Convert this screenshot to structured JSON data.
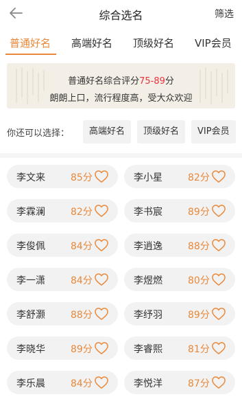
{
  "header": {
    "title": "综合选名",
    "filter_label": "筛选",
    "back_icon": "back-arrow-icon"
  },
  "tabs": [
    {
      "label": "普通好名",
      "active": true
    },
    {
      "label": "高端好名",
      "active": false
    },
    {
      "label": "顶级好名",
      "active": false
    },
    {
      "label": "VIP会员",
      "active": false
    }
  ],
  "banner": {
    "line1_prefix": "普通好名综合评分",
    "score_range": "75-89",
    "line1_suffix": "分",
    "line2": "朗朗上口，流行程度高，受大众欢迎"
  },
  "choose": {
    "label": "你还可以选择：",
    "options": [
      "高端好名",
      "顶级好名",
      "VIP会员"
    ]
  },
  "names": [
    {
      "name": "李文来",
      "score": "85分"
    },
    {
      "name": "李小星",
      "score": "82分"
    },
    {
      "name": "李霖澜",
      "score": "82分"
    },
    {
      "name": "李书宸",
      "score": "89分"
    },
    {
      "name": "李俊佩",
      "score": "84分"
    },
    {
      "name": "李逍逸",
      "score": "88分"
    },
    {
      "name": "李一潇",
      "score": "84分"
    },
    {
      "name": "李煜燃",
      "score": "80分"
    },
    {
      "name": "李舒灏",
      "score": "88分"
    },
    {
      "name": "李纾羽",
      "score": "89分"
    },
    {
      "name": "李晓华",
      "score": "89分"
    },
    {
      "name": "李睿熙",
      "score": "81分"
    },
    {
      "name": "李乐晨",
      "score": "84分"
    },
    {
      "name": "李悦洋",
      "score": "87分"
    }
  ],
  "colors": {
    "accent": "#e9883a",
    "score_range": "#e8323c",
    "card_bg": "#f2f2f2"
  }
}
